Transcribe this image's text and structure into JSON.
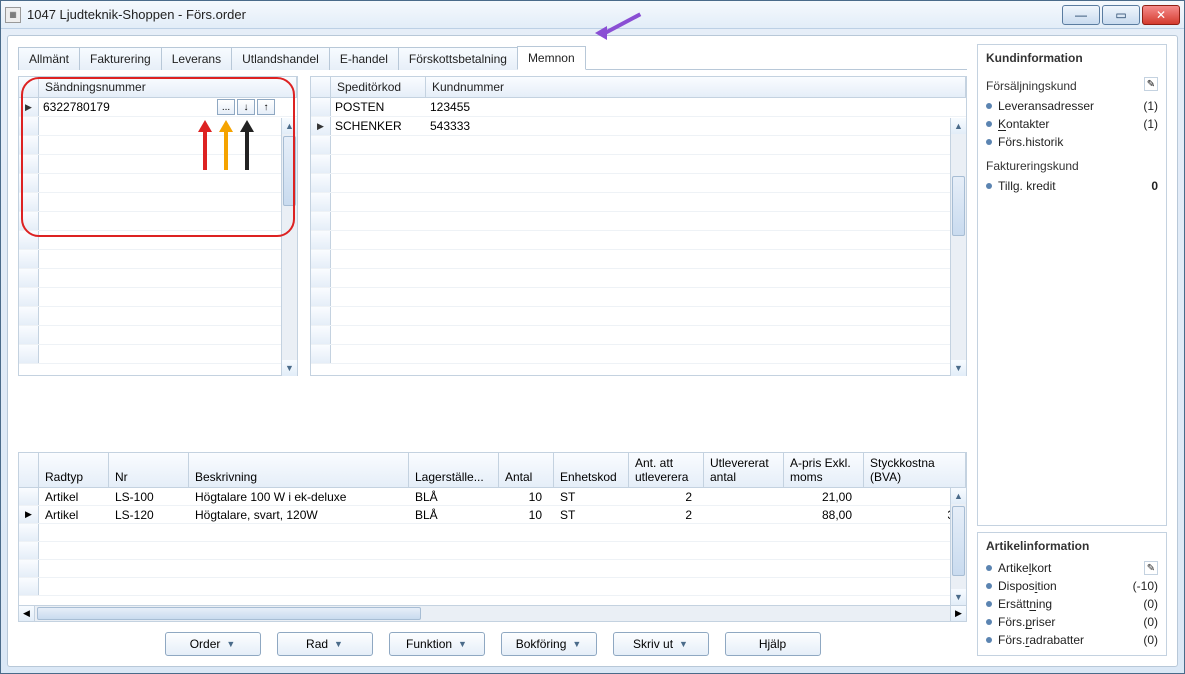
{
  "window": {
    "title": "1047 Ljudteknik-Shoppen - Förs.order"
  },
  "tabs": [
    "Allmänt",
    "Fakturering",
    "Leverans",
    "Utlandshandel",
    "E-handel",
    "Förskottsbetalning",
    "Memnon"
  ],
  "activeTab": "Memnon",
  "shipmentGrid": {
    "header": "Sändningsnummer",
    "rows": [
      {
        "marker": "▶",
        "value": "6322780179",
        "buttons": [
          "...",
          "↓",
          "↑"
        ]
      }
    ]
  },
  "carrierGrid": {
    "headers": [
      "Speditörkod",
      "Kundnummer"
    ],
    "rows": [
      {
        "marker": "",
        "code": "POSTEN",
        "cust": "123455"
      },
      {
        "marker": "▶",
        "code": "SCHENKER",
        "cust": "543333"
      }
    ]
  },
  "linesGrid": {
    "headers": [
      "Radtyp",
      "Nr",
      "Beskrivning",
      "Lagerställe...",
      "Antal",
      "Enhetskod",
      "Ant. att utleverera",
      "Utlevererat antal",
      "A-pris Exkl. moms",
      "Styckkostna (BVA)"
    ],
    "rows": [
      {
        "marker": "",
        "radtyp": "Artikel",
        "nr": "LS-100",
        "beskrivning": "Högtalare 100 W i ek-deluxe",
        "lager": "BLÅ",
        "antal": "10",
        "enhet": "ST",
        "att": "2",
        "utlev": "",
        "apris": "21,00",
        "styck": ""
      },
      {
        "marker": "▶",
        "radtyp": "Artikel",
        "nr": "LS-120",
        "beskrivning": "Högtalare, svart, 120W",
        "lager": "BLÅ",
        "antal": "10",
        "enhet": "ST",
        "att": "2",
        "utlev": "",
        "apris": "88,00",
        "styck": "3"
      }
    ]
  },
  "sidebar": {
    "kund_title": "Kundinformation",
    "fors_kund": "Försäljningskund",
    "leveransadresser": {
      "label": "Leveransadresser",
      "val": "(1)"
    },
    "kontakter": {
      "label": "Kontakter",
      "ul": "K",
      "val": "(1)"
    },
    "fors_historik": {
      "label": "Förs.historik"
    },
    "fakt_kund": "Faktureringskund",
    "tillg_kredit": {
      "label": "Tillg. kredit",
      "val": "0"
    },
    "artikel_title": "Artikelinformation",
    "artikelkort": {
      "label": "Artikelkort",
      "ul": "l"
    },
    "disposition": {
      "label": "Disposition",
      "ul": "i",
      "val": "(-10)"
    },
    "ersattning": {
      "label": "Ersättning",
      "ul": "n",
      "val": "(0)"
    },
    "fors_priser": {
      "label": "Förs.priser",
      "ul": "p",
      "val": "(0)"
    },
    "fors_radrabatter": {
      "label": "Förs.radrabatter",
      "ul": "r",
      "val": "(0)"
    }
  },
  "buttons": {
    "order": "Order",
    "rad": "Rad",
    "funktion": "Funktion",
    "bokforing": "Bokföring",
    "skriv_ut": "Skriv ut",
    "hjalp": "Hjälp"
  }
}
